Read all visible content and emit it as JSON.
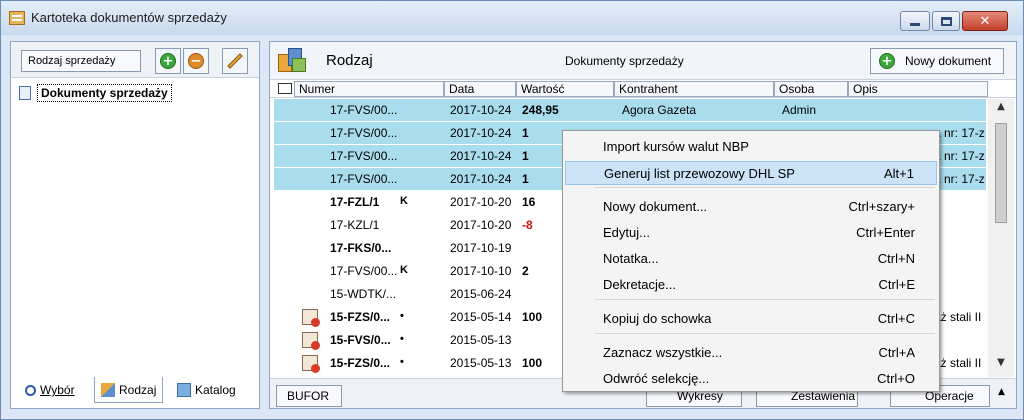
{
  "window": {
    "title": "Kartoteka dokumentów sprzedaży"
  },
  "left": {
    "rodzaj_label": "Rodzaj sprzedaży",
    "tree_item": "Dokumenty sprzedaży",
    "tabs": [
      "Wybór",
      "Rodzaj",
      "Katalog"
    ]
  },
  "right": {
    "title": "Rodzaj",
    "subtitle": "Dokumenty sprzedaży",
    "new_doc": "Nowy dokument",
    "columns": [
      "Numer",
      "Data",
      "Wartość",
      "Kontrahent",
      "Osoba",
      "Opis"
    ],
    "rows": [
      {
        "num": "17-FVS/00...",
        "date": "2017-10-24",
        "val": "248,95",
        "contr": "Agora Gazeta",
        "osoba": "Admin",
        "opis": "",
        "sel": true,
        "boldnum": false,
        "flag": ""
      },
      {
        "num": "17-FVS/00...",
        "date": "2017-10-24",
        "val": "1",
        "contr": "",
        "osoba": "",
        "opis": "a nr: 17-z",
        "sel": true,
        "boldnum": false,
        "flag": ""
      },
      {
        "num": "17-FVS/00...",
        "date": "2017-10-24",
        "val": "1",
        "contr": "",
        "osoba": "",
        "opis": "a nr: 17-z",
        "sel": true,
        "boldnum": false,
        "flag": ""
      },
      {
        "num": "17-FVS/00...",
        "date": "2017-10-24",
        "val": "1",
        "contr": "",
        "osoba": "",
        "opis": "a nr: 17-z",
        "sel": true,
        "boldnum": false,
        "flag": ""
      },
      {
        "num": "17-FZL/1",
        "date": "2017-10-20",
        "val": "16",
        "contr": "",
        "osoba": "",
        "opis": "",
        "sel": false,
        "boldnum": true,
        "flag": "K"
      },
      {
        "num": "17-KZL/1",
        "date": "2017-10-20",
        "val": "-8",
        "contr": "",
        "osoba": "",
        "opis": "",
        "sel": false,
        "boldnum": false,
        "flag": ""
      },
      {
        "num": "17-FKS/0...",
        "date": "2017-10-19",
        "val": "",
        "contr": "",
        "osoba": "",
        "opis": "",
        "sel": false,
        "boldnum": true,
        "flag": ""
      },
      {
        "num": "17-FVS/00...",
        "date": "2017-10-10",
        "val": "2",
        "contr": "",
        "osoba": "",
        "opis": "",
        "sel": false,
        "boldnum": false,
        "flag": "K"
      },
      {
        "num": "15-WDTK/...",
        "date": "2015-06-24",
        "val": "",
        "contr": "",
        "osoba": "",
        "opis": "",
        "sel": false,
        "boldnum": false,
        "flag": ""
      },
      {
        "num": "15-FZS/0...",
        "date": "2015-05-14",
        "val": "100",
        "contr": "",
        "osoba": "",
        "opis": "aż stali II",
        "sel": false,
        "boldnum": true,
        "flag": "•",
        "icon": true
      },
      {
        "num": "15-FVS/0...",
        "date": "2015-05-13",
        "val": "",
        "contr": "",
        "osoba": "",
        "opis": "",
        "sel": false,
        "boldnum": true,
        "flag": "•",
        "icon": true
      },
      {
        "num": "15-FZS/0...",
        "date": "2015-05-13",
        "val": "100",
        "contr": "",
        "osoba": "",
        "opis": "aż stali II",
        "sel": false,
        "boldnum": true,
        "flag": "•",
        "icon": true
      }
    ],
    "bottom": {
      "bufor": "BUFOR",
      "wykresy": "Wykresy",
      "zestawienia": "Zestawienia",
      "operacje": "Operacje"
    }
  },
  "context_menu": [
    {
      "label": "Import kursów walut NBP",
      "shortcut": ""
    },
    {
      "label": "Generuj list przewozowy DHL SP",
      "shortcut": "Alt+1",
      "highlight": true
    },
    {
      "label": "Nowy dokument...",
      "shortcut": "Ctrl+szary+"
    },
    {
      "label": "Edytuj...",
      "shortcut": "Ctrl+Enter"
    },
    {
      "label": "Notatka...",
      "shortcut": "Ctrl+N"
    },
    {
      "label": "Dekretacje...",
      "shortcut": "Ctrl+E"
    },
    {
      "label": "Kopiuj do schowka",
      "shortcut": "Ctrl+C"
    },
    {
      "label": "Zaznacz wszystkie...",
      "shortcut": "Ctrl+A"
    },
    {
      "label": "Odwróć selekcję...",
      "shortcut": "Ctrl+O"
    }
  ]
}
